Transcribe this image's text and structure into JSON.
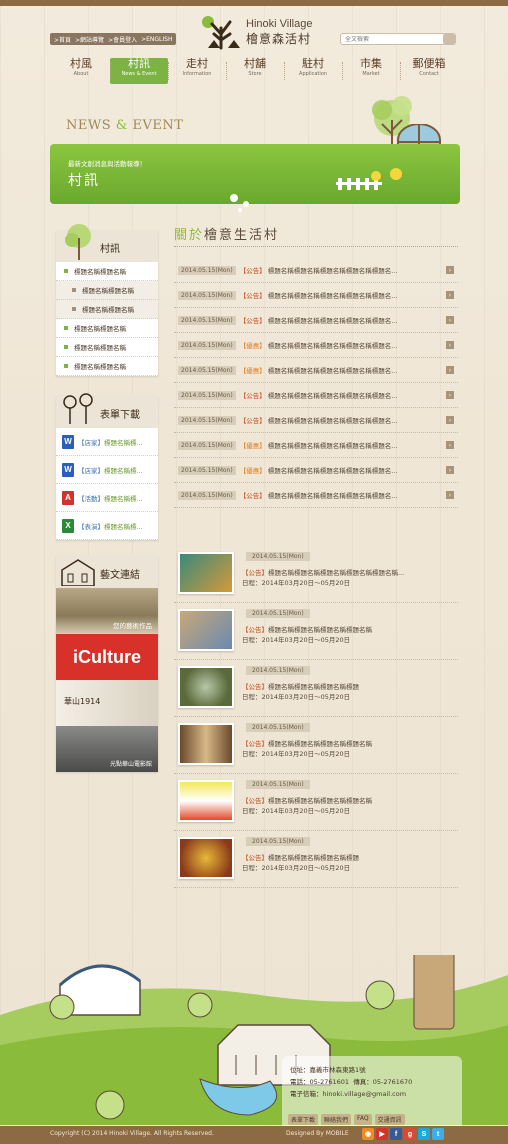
{
  "header": {
    "utility_links": [
      ">首頁",
      ">網站導覽",
      ">會員登入",
      ">ENGLISH"
    ],
    "logo_en": "Hinoki Village",
    "logo_zh": "檜意森活村",
    "search_placeholder": "全文檢索"
  },
  "nav": [
    {
      "zh": "村風",
      "en": "About"
    },
    {
      "zh": "村訊",
      "en": "News & Event"
    },
    {
      "zh": "走村",
      "en": "Information"
    },
    {
      "zh": "村舖",
      "en": "Store"
    },
    {
      "zh": "駐村",
      "en": "Application"
    },
    {
      "zh": "市集",
      "en": "Market"
    },
    {
      "zh": "郵便箱",
      "en": "Contact"
    }
  ],
  "hero": {
    "heading_left": "NEWS",
    "heading_amp": "&",
    "heading_right": "EVENT",
    "banner_sub": "最新文創消息與活動報導！",
    "banner_title": "村訊"
  },
  "sidebar": {
    "news_box": {
      "title": "村訊",
      "items": [
        {
          "label": "標題名稱標題名稱",
          "sub": false
        },
        {
          "label": "標題名稱標題名稱",
          "sub": true
        },
        {
          "label": "標題名稱標題名稱",
          "sub": true
        },
        {
          "label": "標題名稱標題名稱",
          "sub": false
        },
        {
          "label": "標題名稱標題名稱",
          "sub": false
        },
        {
          "label": "標題名稱標題名稱",
          "sub": false
        }
      ]
    },
    "download_box": {
      "title": "表單下載",
      "items": [
        {
          "icon": "W",
          "color": "#2b5fb8",
          "tag": "【店家】",
          "text": "標題名稱標..."
        },
        {
          "icon": "W",
          "color": "#2b5fb8",
          "tag": "【店家】",
          "text": "標題名稱標..."
        },
        {
          "icon": "A",
          "color": "#d4322c",
          "tag": "【活動】",
          "text": "標題名稱標..."
        },
        {
          "icon": "X",
          "color": "#2a8a3a",
          "tag": "【表演】",
          "text": "標題名稱標..."
        }
      ]
    },
    "arts_box": {
      "title": "藝文連結",
      "items": [
        "您的藝術作品",
        "iCulture",
        "華山1914",
        "光點華山電影館"
      ]
    }
  },
  "main": {
    "title_highlight": "關於",
    "title_rest": "檜意生活村",
    "news": [
      {
        "date": "2014.05.15(Mon)",
        "cat": "【公告】",
        "tips": false,
        "text": "標題名稱標題名稱標題名稱標題名稱標題名..."
      },
      {
        "date": "2014.05.15(Mon)",
        "cat": "【公告】",
        "tips": false,
        "text": "標題名稱標題名稱標題名稱標題名稱標題名..."
      },
      {
        "date": "2014.05.15(Mon)",
        "cat": "【公告】",
        "tips": false,
        "text": "標題名稱標題名稱標題名稱標題名稱標題名..."
      },
      {
        "date": "2014.05.15(Mon)",
        "cat": "【優惠】",
        "tips": true,
        "text": "標題名稱標題名稱標題名稱標題名稱標題名..."
      },
      {
        "date": "2014.05.15(Mon)",
        "cat": "【優惠】",
        "tips": true,
        "text": "標題名稱標題名稱標題名稱標題名稱標題名..."
      },
      {
        "date": "2014.05.15(Mon)",
        "cat": "【公告】",
        "tips": false,
        "text": "標題名稱標題名稱標題名稱標題名稱標題名..."
      },
      {
        "date": "2014.05.15(Mon)",
        "cat": "【公告】",
        "tips": false,
        "text": "標題名稱標題名稱標題名稱標題名稱標題名..."
      },
      {
        "date": "2014.05.15(Mon)",
        "cat": "【優惠】",
        "tips": true,
        "text": "標題名稱標題名稱標題名稱標題名稱標題名..."
      },
      {
        "date": "2014.05.15(Mon)",
        "cat": "【優惠】",
        "tips": true,
        "text": "標題名稱標題名稱標題名稱標題名稱標題名..."
      },
      {
        "date": "2014.05.15(Mon)",
        "cat": "【公告】",
        "tips": false,
        "text": "標題名稱標題名稱標題名稱標題名稱標題名..."
      }
    ],
    "events": [
      {
        "date": "2014.05.15(Mon)",
        "cat": "【公告】",
        "text": "標題名稱標題名稱標題名稱標題名稱標題名稱...",
        "when": "日程：2014年03月20日～05月20日",
        "thumb": [
          "#3a8a7a",
          "#d49a3a"
        ]
      },
      {
        "date": "2014.05.15(Mon)",
        "cat": "【公告】",
        "text": "標題名稱標題名稱標題名稱標題名稱",
        "when": "日程：2014年03月20日～05月20日",
        "thumb": [
          "#c8a878",
          "#6a8ab0"
        ]
      },
      {
        "date": "2014.05.15(Mon)",
        "cat": "【公告】",
        "text": "標題名稱標題名稱標題名稱標題",
        "when": "日程：2014年03月20日～05月20日",
        "thumb": [
          "#5a6a3a",
          "#b8c8a8"
        ]
      },
      {
        "date": "2014.05.15(Mon)",
        "cat": "【公告】",
        "text": "標題名稱標題名稱標題名稱標題名稱",
        "when": "日程：2014年03月20日～05月20日",
        "thumb": [
          "#6a4a2a",
          "#d8b888"
        ]
      },
      {
        "date": "2014.05.15(Mon)",
        "cat": "【公告】",
        "text": "標題名稱標題名稱標題名稱標題名稱",
        "when": "日程：2014年03月20日～05月20日",
        "thumb": [
          "#f4e85a",
          "#e04a2a"
        ]
      },
      {
        "date": "2014.05.15(Mon)",
        "cat": "【公告】",
        "text": "標題名稱標題名稱標題名稱標題",
        "when": "日程：2014年03月20日～05月20日",
        "thumb": [
          "#8a3a1a",
          "#e8b83a"
        ]
      }
    ]
  },
  "footer": {
    "address_label": "位址：",
    "address": "嘉義市林森東路1號",
    "phone_label": "電話：",
    "phone": "05-2761601",
    "fax_label": "傳真：",
    "fax": "05-2761670",
    "email_label": "電子信箱：",
    "email": "hinoki.village@gmail.com",
    "buttons": [
      "表單下載",
      "聯絡我們",
      "FAQ",
      "交通資訊"
    ],
    "copyright": "Copyright (C) 2014 Hinoki Village.    All Rights Reserved.",
    "designed_by": "Designed By",
    "designer": "MOBILE",
    "social": [
      {
        "icon": "rss-icon",
        "glyph": "◉",
        "color": "#f08a24"
      },
      {
        "icon": "youtube-icon",
        "glyph": "▶",
        "color": "#d8312a"
      },
      {
        "icon": "facebook-icon",
        "glyph": "f",
        "color": "#3b5998"
      },
      {
        "icon": "google-plus-icon",
        "glyph": "g",
        "color": "#d84a38"
      },
      {
        "icon": "skype-icon",
        "glyph": "S",
        "color": "#1aa8e0"
      },
      {
        "icon": "twitter-icon",
        "glyph": "t",
        "color": "#38b0e8"
      }
    ]
  }
}
